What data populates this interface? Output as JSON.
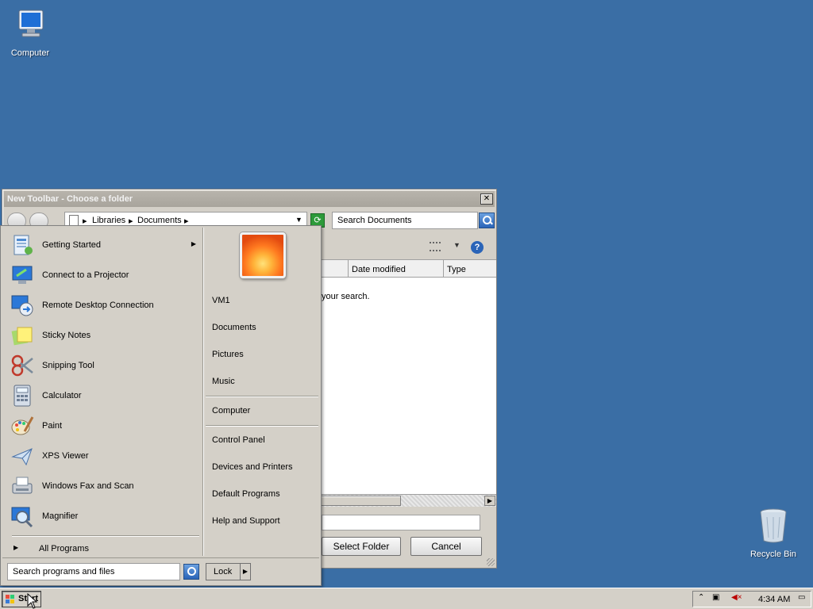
{
  "desktop": {
    "icons": [
      {
        "label": "Computer"
      },
      {
        "label": "Recycle Bin"
      }
    ]
  },
  "dialog": {
    "title": "New Toolbar - Choose a folder",
    "close_label": "✕",
    "address": {
      "crumbs": [
        "Libraries",
        "Documents"
      ]
    },
    "search_placeholder": "Search Documents",
    "columns": [
      "Date modified",
      "Type"
    ],
    "empty_message": "your search.",
    "select_button": "Select Folder",
    "cancel_button": "Cancel",
    "help_label": "?"
  },
  "start_menu": {
    "programs": [
      {
        "label": "Getting Started",
        "icon": "getting-started-icon",
        "submenu": true
      },
      {
        "label": "Connect to a Projector",
        "icon": "projector-icon"
      },
      {
        "label": "Remote Desktop Connection",
        "icon": "remote-desktop-icon"
      },
      {
        "label": "Sticky Notes",
        "icon": "sticky-notes-icon"
      },
      {
        "label": "Snipping Tool",
        "icon": "scissors-icon"
      },
      {
        "label": "Calculator",
        "icon": "calculator-icon"
      },
      {
        "label": "Paint",
        "icon": "paint-palette-icon"
      },
      {
        "label": "XPS Viewer",
        "icon": "xps-viewer-icon"
      },
      {
        "label": "Windows Fax and Scan",
        "icon": "fax-icon"
      },
      {
        "label": "Magnifier",
        "icon": "magnifier-icon"
      }
    ],
    "all_programs": "All Programs",
    "search_placeholder": "Search programs and files",
    "lock_label": "Lock",
    "right_links": [
      "VM1",
      "Documents",
      "Pictures",
      "Music",
      "Computer",
      "Control Panel",
      "Devices and Printers",
      "Default Programs",
      "Help and Support"
    ]
  },
  "taskbar": {
    "start_label": "Start",
    "clock": "4:34 AM"
  },
  "colors": {
    "desktop": "#3a6ea5",
    "chrome": "#d4d0c8",
    "search_blue": "#2a64b8"
  }
}
